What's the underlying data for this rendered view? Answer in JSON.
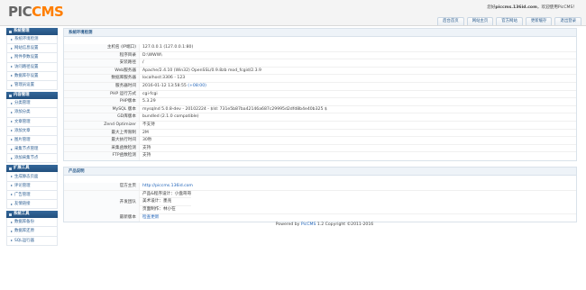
{
  "header": {
    "logo_text_1": "PIC",
    "logo_text_2": "CMS",
    "welcome_prefix": "您好",
    "welcome_site": "piccms.136id.com",
    "welcome_suffix": "，欢迎使用PicCMS！",
    "tabs": [
      "后台首页",
      "网站主页",
      "官方网站",
      "更新缓存",
      "退出登录"
    ]
  },
  "sidebar": {
    "groups": [
      {
        "title": "系统管理",
        "items": [
          "系统环境检测",
          "网站信息设置",
          "附件参数设置",
          "访问路径设置",
          "数据库存设置",
          "管理员设置"
        ]
      },
      {
        "title": "内容管理",
        "items": [
          "分类管理",
          "添加分类",
          "文章管理",
          "添加文章",
          "图片管理",
          "采集节点管理",
          "添加采集节点"
        ]
      },
      {
        "title": "扩展工具",
        "items": [
          "生成静态页面",
          "评论管理",
          "广告管理",
          "友情链接"
        ]
      },
      {
        "title": "系统工具",
        "items": [
          "数据库备份",
          "数据库还原",
          "SQL运行器"
        ]
      }
    ]
  },
  "env_panel": {
    "title": "系统环境检测",
    "rows": [
      {
        "label": "主机名 (IP端口)",
        "value": "127.0.0.1 (127.0.0.1:80)"
      },
      {
        "label": "程序目录",
        "value": "D:\\WWW\\"
      },
      {
        "label": "安装路径",
        "value": "/"
      },
      {
        "label": "Web服务器",
        "value": "Apache/2.4.10 (Win32) OpenSSL/0.9.8zb mod_fcgid/2.3.9"
      },
      {
        "label": "数据库服务器",
        "value": "localhost:3306 - 123"
      },
      {
        "label": "服务器时间",
        "value": "2016-01-12 13:58:55",
        "extra": "(+08:00)"
      },
      {
        "label": "PHP 运行方式",
        "value": "cgi-fcgi"
      },
      {
        "label": "PHP版本",
        "value": "5.3.29"
      },
      {
        "label": "MySQL 版本",
        "value": "mysqlnd 5.0.8-dev - 20102224 - $Id: 731e5b87ba42146a687c29995d2dfd8b4e40b325 $"
      },
      {
        "label": "GD库版本",
        "value": "bundled (2.1.0 compatible)"
      },
      {
        "label": "Zend Optimizer",
        "value": "不支持"
      },
      {
        "label": "最大上传限制",
        "value": "2M"
      },
      {
        "label": "最大执行时间",
        "value": "30秒"
      },
      {
        "label": "采集函数检测",
        "value": "支持"
      },
      {
        "label": "FTP函数检测",
        "value": "支持"
      }
    ]
  },
  "product_panel": {
    "title": "产品说明",
    "homepage_label": "官方主页",
    "homepage_url": "http://piccms.136id.com",
    "team_label": "开发团队",
    "team": [
      "产品&程序设计：小盘哥哥",
      "美术设计：墨兆",
      "页面制作：林小在"
    ],
    "update_label": "最新版本",
    "update_link": "检查更新"
  },
  "footer": {
    "prefix": "Powered by ",
    "brand": "PicCMS",
    "suffix": " 1.2 Copyright ©2011-2016"
  }
}
